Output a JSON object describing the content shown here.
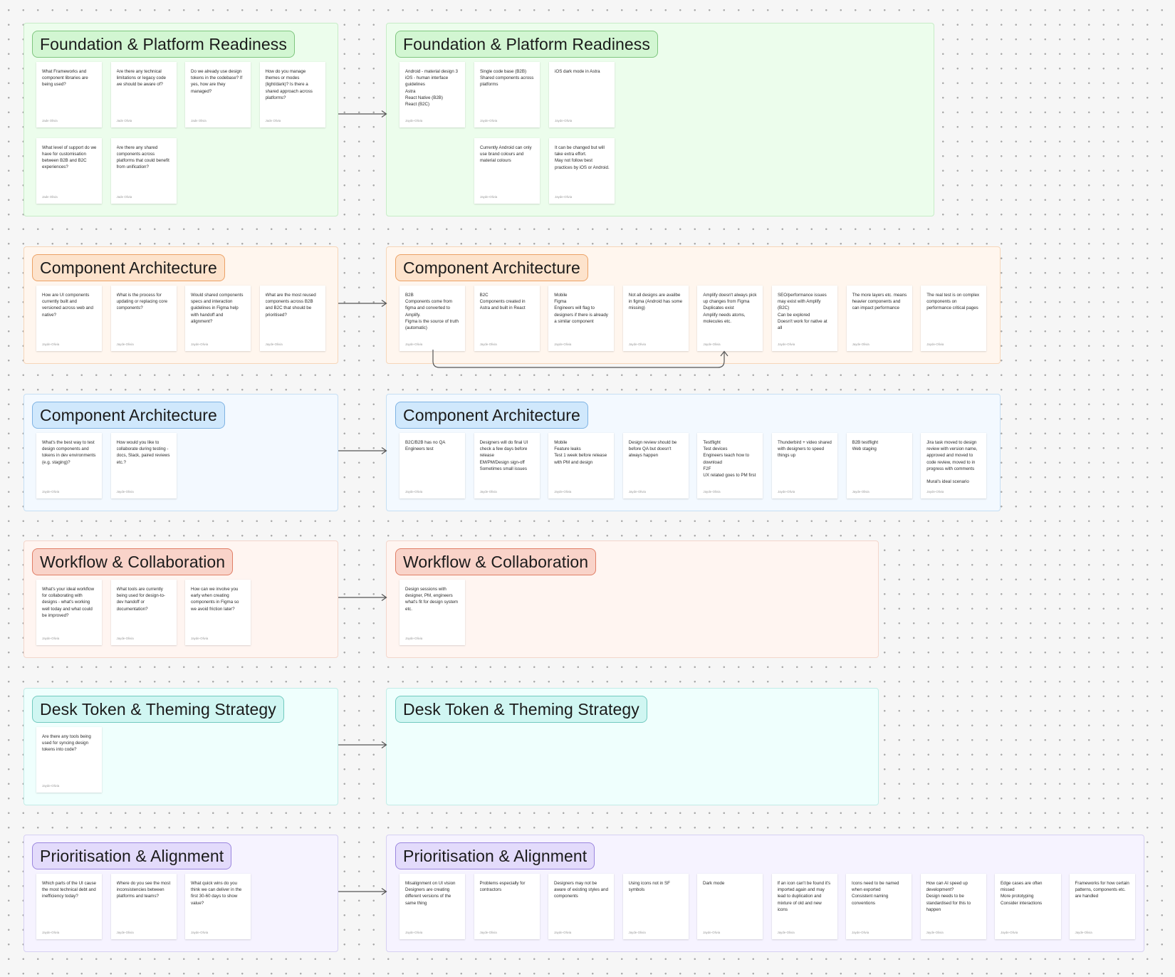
{
  "sections": [
    {
      "title": "Foundation & Platform Readiness",
      "questions": [
        {
          "text": "What Frameworks and component libraries are being used?",
          "author": "Jade Olivia"
        },
        {
          "text": "Are there any technical limitations or legacy code we should be aware of?",
          "author": "Jade Olivia"
        },
        {
          "text": "Do we already use design tokens in the codebase? If yes, how are they managed?",
          "author": "Jade Olivia"
        },
        {
          "text": "How do you manage themes or modes (light/dark)? Is there a shared approach across platforms?",
          "author": "Jade Olivia"
        },
        {
          "text": "What level of support do we have for customisation between B2B and B2C experiences?",
          "author": "Jade Olivia"
        },
        {
          "text": "Are there any shared components across platforms that could benefit from unification?",
          "author": "Jade Olivia"
        }
      ],
      "answers": [
        {
          "text": "Android - material design 3\niOS - human interface guidelines\nAstra\nReact Native (B2B)\nReact (B2C)",
          "author": "Jayde-Olivia"
        },
        {
          "text": "Single code base (B2B)\nShared components across platforms",
          "author": "Jayde-Olivia"
        },
        {
          "text": "iOS dark mode in Astra",
          "author": "Jayde-Olivia"
        },
        {
          "text": "Currently Android can only use brand colours and material colours",
          "author": "Jayde-Olivia"
        },
        {
          "text": "It can be changed but will take extra effort.\nMay not follow best practices by iOS or Android.",
          "author": "Jayde-Olivia"
        }
      ]
    },
    {
      "title": "Component Architecture",
      "questions": [
        {
          "text": "How are UI components currently built and versioned across web and native?",
          "author": "Jayde-Olivia"
        },
        {
          "text": "What is the process for updating or replacing core components?",
          "author": "Jayde-Olivia"
        },
        {
          "text": "Would shared components specs and interaction guidelines in Figma help with handoff and alignment?",
          "author": "Jayde-Olivia"
        },
        {
          "text": "What are the most reused components across B2B and B2C that should be prioritised?",
          "author": "Jayde-Olivia"
        }
      ],
      "answers": [
        {
          "text": "B2B\nComponents come from figma and converted to Amplify.\nFigma is the source of truth (automatic)",
          "author": "Jayde-Olivia"
        },
        {
          "text": "B2C\nComponents created in Astra and built in React",
          "author": "Jayde-Olivia"
        },
        {
          "text": "Mobile\nFigma\nEngineers will flag to designers if there is already a similar component",
          "author": "Jayde-Olivia"
        },
        {
          "text": "Not all designs are availbe in figma (Android has some missing)",
          "author": "Jayde-Olivia"
        },
        {
          "text": "Amplify doesn't always pick up changes from Figma\nDuplicates exist\nAmplify needs atoms, molecules etc.",
          "author": "Jayde-Olivia"
        },
        {
          "text": "SEO/performance issues may exist with Amplify (B2C)\nCan be explored\nDoesn't work for native at all",
          "author": "Jayde-Olivia"
        },
        {
          "text": "The more layers etc. means heavier components and can impact performance",
          "author": "Jayde-Olivia"
        },
        {
          "text": "The real test is on complex components on performance critical pages",
          "author": "Jayde-Olivia"
        }
      ]
    },
    {
      "title": "Component Architecture",
      "questions": [
        {
          "text": "What's the best way to test design components and tokens in dev environments (e.g. staging)?",
          "author": "Jayde-Olivia"
        },
        {
          "text": "How would you like to collaborate during testing - docs, Slack, paired reviews etc.?",
          "author": "Jayde-Olivia"
        }
      ],
      "answers": [
        {
          "text": "B2C/B2B has no QA\nEngineers test",
          "author": "Jayde-Olivia"
        },
        {
          "text": "Designers will do final UI check a few days before release\nEM/PM/Design sign-off\nSometimes small issues",
          "author": "Jayde-Olivia"
        },
        {
          "text": "Mobile\nFeature leaks\nTest 1 week before release with PM and design",
          "author": "Jayde-Olivia"
        },
        {
          "text": "Design review should be before QA but doesn't always happen",
          "author": "Jayde-Olivia"
        },
        {
          "text": "Testflight\nTest devices\nEngineers teach how to download\nF2F\nUX related goes to PM first",
          "author": "Jayde-Olivia"
        },
        {
          "text": "Thunderbird + video shared with designers to speed things up",
          "author": "Jayde-Olivia"
        },
        {
          "text": "B2B testflight\nWeb staging",
          "author": "Jayde-Olivia"
        },
        {
          "text": "Jira task moved to design review with version name, approved and moved to code review, moved to in progress with comments\n\nMural's ideal scenario",
          "author": "Jayde-Olivia"
        }
      ]
    },
    {
      "title": "Workflow & Collaboration",
      "questions": [
        {
          "text": "What's your ideal workflow for collaborating with designs - what's working well today and what could be improved?",
          "author": "Jayde-Olivia"
        },
        {
          "text": "What tools are currently being used for design-to-dev handoff or documentation?",
          "author": "Jayde-Olivia"
        },
        {
          "text": "How can we involve you early when creating components in Figma so we avoid friction later?",
          "author": "Jayde-Olivia"
        }
      ],
      "answers": [
        {
          "text": "Design sessions with designer, PM, engineers what's fit for design system etc.",
          "author": "Jayde-Olivia"
        }
      ]
    },
    {
      "title": "Desk Token & Theming Strategy",
      "questions": [
        {
          "text": "Are there any tools being used for syncing design tokens into code?",
          "author": "Jayde-Olivia"
        }
      ],
      "answers": []
    },
    {
      "title": "Prioritisation & Alignment",
      "questions": [
        {
          "text": "Which parts of the UI cause the most technical debt and inefficiency today?",
          "author": "Jayde-Olivia"
        },
        {
          "text": "Where do you see the most inconsistencies between platforms and teams?",
          "author": "Jayde-Olivia"
        },
        {
          "text": "What quick wins do you think we can deliver in the first 30-60 days to show value?",
          "author": "Jayde-Olivia"
        }
      ],
      "answers": [
        {
          "text": "Misalignment on UI vision\nDesigners are creating different versions of the same thing",
          "author": "Jayde-Olivia"
        },
        {
          "text": "Problems especially for contractors",
          "author": "Jayde-Olivia"
        },
        {
          "text": "Designers may not be aware of existing styles and components",
          "author": "Jayde-Olivia"
        },
        {
          "text": "Using icons not in SF symbols",
          "author": "Jayde-Olivia"
        },
        {
          "text": "Dark mode",
          "author": "Jayde-Olivia"
        },
        {
          "text": "If an icon can't be found it's imported again and may lead to duplication and mixture of old and new icons",
          "author": "Jayde-Olivia"
        },
        {
          "text": "Icons need to be named when exported\nConsistent naming conventions",
          "author": "Jayde-Olivia"
        },
        {
          "text": "How can AI speed up development?\nDesign needs to be standardised for this to happen",
          "author": "Jayde-Olivia"
        },
        {
          "text": "Edge cases are often missed\nMore prototyping\nConsider interactions",
          "author": "Jayde-Olivia"
        },
        {
          "text": "Frameworks for how certain patterns, components etc. are handled",
          "author": "Jayde-Olivia"
        }
      ]
    }
  ],
  "theme": {
    "colors": [
      {
        "bg": "#ecfdec",
        "border": "#c7ecc7",
        "pill": "#d2f6d2",
        "pill_border": "#7fc67f"
      },
      {
        "bg": "#fff6ee",
        "border": "#f6d6b9",
        "pill": "#fde3cc",
        "pill_border": "#eca266"
      },
      {
        "bg": "#f3f9ff",
        "border": "#c6dff4",
        "pill": "#d0e8fc",
        "pill_border": "#7fb3e3"
      },
      {
        "bg": "#fff5f1",
        "border": "#f3d6cb",
        "pill": "#f9d3c9",
        "pill_border": "#e07e66"
      },
      {
        "bg": "#effffd",
        "border": "#c2ece7",
        "pill": "#d0f6f2",
        "pill_border": "#72cabf"
      },
      {
        "bg": "#f6f3ff",
        "border": "#d6d0f2",
        "pill": "#e3dbfb",
        "pill_border": "#9b86de"
      }
    ],
    "connector_color": "#555555",
    "icons": {
      "arrow": "arrow-right-icon",
      "loop": "loop-connector-icon"
    }
  }
}
